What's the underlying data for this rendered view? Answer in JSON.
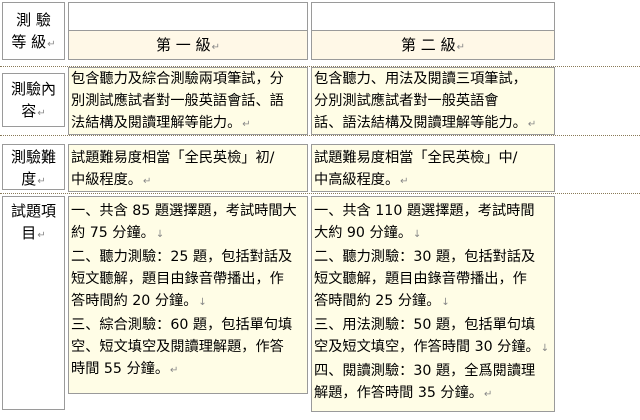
{
  "row_labels": {
    "level": [
      "測 驗",
      "等 級"
    ],
    "content": [
      "測驗內",
      "容"
    ],
    "difficulty": [
      "測驗難",
      "度"
    ],
    "items": [
      "試題項",
      "目"
    ]
  },
  "columns": {
    "level1": {
      "header": "第 一 級",
      "content": [
        "包含聽力及綜合測驗兩項筆試，分",
        "別測試應試者對一般英語會話、語",
        "法結構及閱讀理解等能力。"
      ],
      "difficulty": [
        "試題難易度相當「全民英檢」初/",
        "中級程度。"
      ],
      "items": [
        "一、共含 85 題選擇題，考試時間大",
        "約 75 分鐘。",
        "二、聽力測驗：25 題，包括對話及",
        "短文聽解，題目由錄音帶播出，作",
        "答時間約 20 分鐘。",
        "三、綜合測驗：60 題，包括單句填",
        "空、短文填空及閱讀理解題，作答",
        "時間 55 分鐘。"
      ]
    },
    "level2": {
      "header": "第 二 級",
      "content": [
        "包含聽力、用法及閱讀三項筆試，",
        "分別測試應試者對一般英語會",
        "話、語法結構及閱讀理解等能力。"
      ],
      "difficulty": [
        "試題難易度相當「全民英檢」中/",
        "中高級程度。"
      ],
      "items": [
        "一、共含 110 題選擇題，考試時間",
        "大約 90 分鐘。",
        "二、聽力測驗：30 題，包括對話及",
        "短文聽解，題目由錄音帶播出，作",
        "答時間約 25 分鐘。",
        "三、用法測驗：50 題，包括單句填",
        "空及短文填空，作答時間 30 分鐘。",
        "四、閱讀測驗：30 題，全爲閱讀理",
        "解題，作答時間 35 分鐘。"
      ]
    }
  },
  "marks": {
    "paragraph": "↵",
    "line": "↓"
  }
}
